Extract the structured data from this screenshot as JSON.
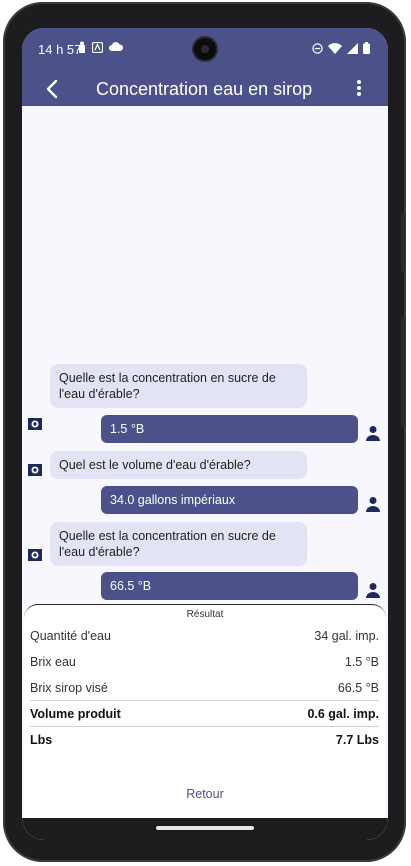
{
  "status_bar": {
    "time": "14 h 57"
  },
  "app_bar": {
    "title": "Concentration eau en sirop"
  },
  "conversation": [
    {
      "role": "question",
      "text": "Quelle est la concentration en sucre de l'eau d'érable?"
    },
    {
      "role": "answer",
      "text": "1.5 °B"
    },
    {
      "role": "question",
      "text": "Quel est le volume d'eau d'érable?"
    },
    {
      "role": "answer",
      "text": "34.0 gallons impériaux"
    },
    {
      "role": "question",
      "text": "Quelle est la concentration en sucre de l'eau d'érable?"
    },
    {
      "role": "answer",
      "text": "66.5 °B"
    }
  ],
  "result": {
    "title": "Résultat",
    "rows": [
      {
        "label": "Quantité d'eau",
        "value": "34 gal. imp."
      },
      {
        "label": "Brix eau",
        "value": "1.5 °B"
      },
      {
        "label": "Brix sirop visé",
        "value": "66.5 °B"
      },
      {
        "label": "Volume produit",
        "value": "0.6 gal. imp."
      },
      {
        "label": "Lbs",
        "value": "7.7 Lbs"
      }
    ],
    "back_label": "Retour"
  },
  "colors": {
    "primary": "#4c5189",
    "question_bubble": "#e2e3f4",
    "background": "#f8f7fe"
  }
}
